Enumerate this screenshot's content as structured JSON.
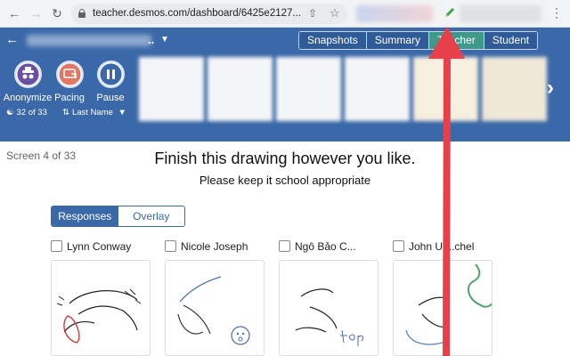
{
  "browser": {
    "url": "teacher.desmos.com/dashboard/6425e2127...",
    "icons": {
      "back": "back-arrow-icon",
      "forward": "forward-arrow-icon",
      "reload": "reload-icon",
      "lock": "lock-icon",
      "share": "share-icon",
      "bookmark": "star-icon",
      "extension": "pencil-icon",
      "menu": "kebab-menu-icon"
    }
  },
  "header": {
    "title_suffix": "..",
    "views": [
      "Snapshots",
      "Summary",
      "Teacher",
      "Student"
    ],
    "active_view": "Teacher"
  },
  "toolbar": {
    "anonymize_label": "Anonymize",
    "pacing_label": "Pacing",
    "pause_label": "Pause",
    "student_count": "32 of 33",
    "sort_label": "Last Name",
    "accent_color": "#3a68a8"
  },
  "content": {
    "screen_counter": "Screen 4 of 33",
    "prompt_title": "Finish this drawing however you like.",
    "prompt_subtitle": "Please keep it school appropriate",
    "mode_tabs": [
      "Responses",
      "Overlay"
    ],
    "active_mode": "Responses"
  },
  "students": [
    {
      "name": "Lynn Conway"
    },
    {
      "name": "Nicole Joseph"
    },
    {
      "name": "Ngô Bảo C..."
    },
    {
      "name": "John Un..chel"
    }
  ],
  "annotation": {
    "color": "#e8404a"
  }
}
